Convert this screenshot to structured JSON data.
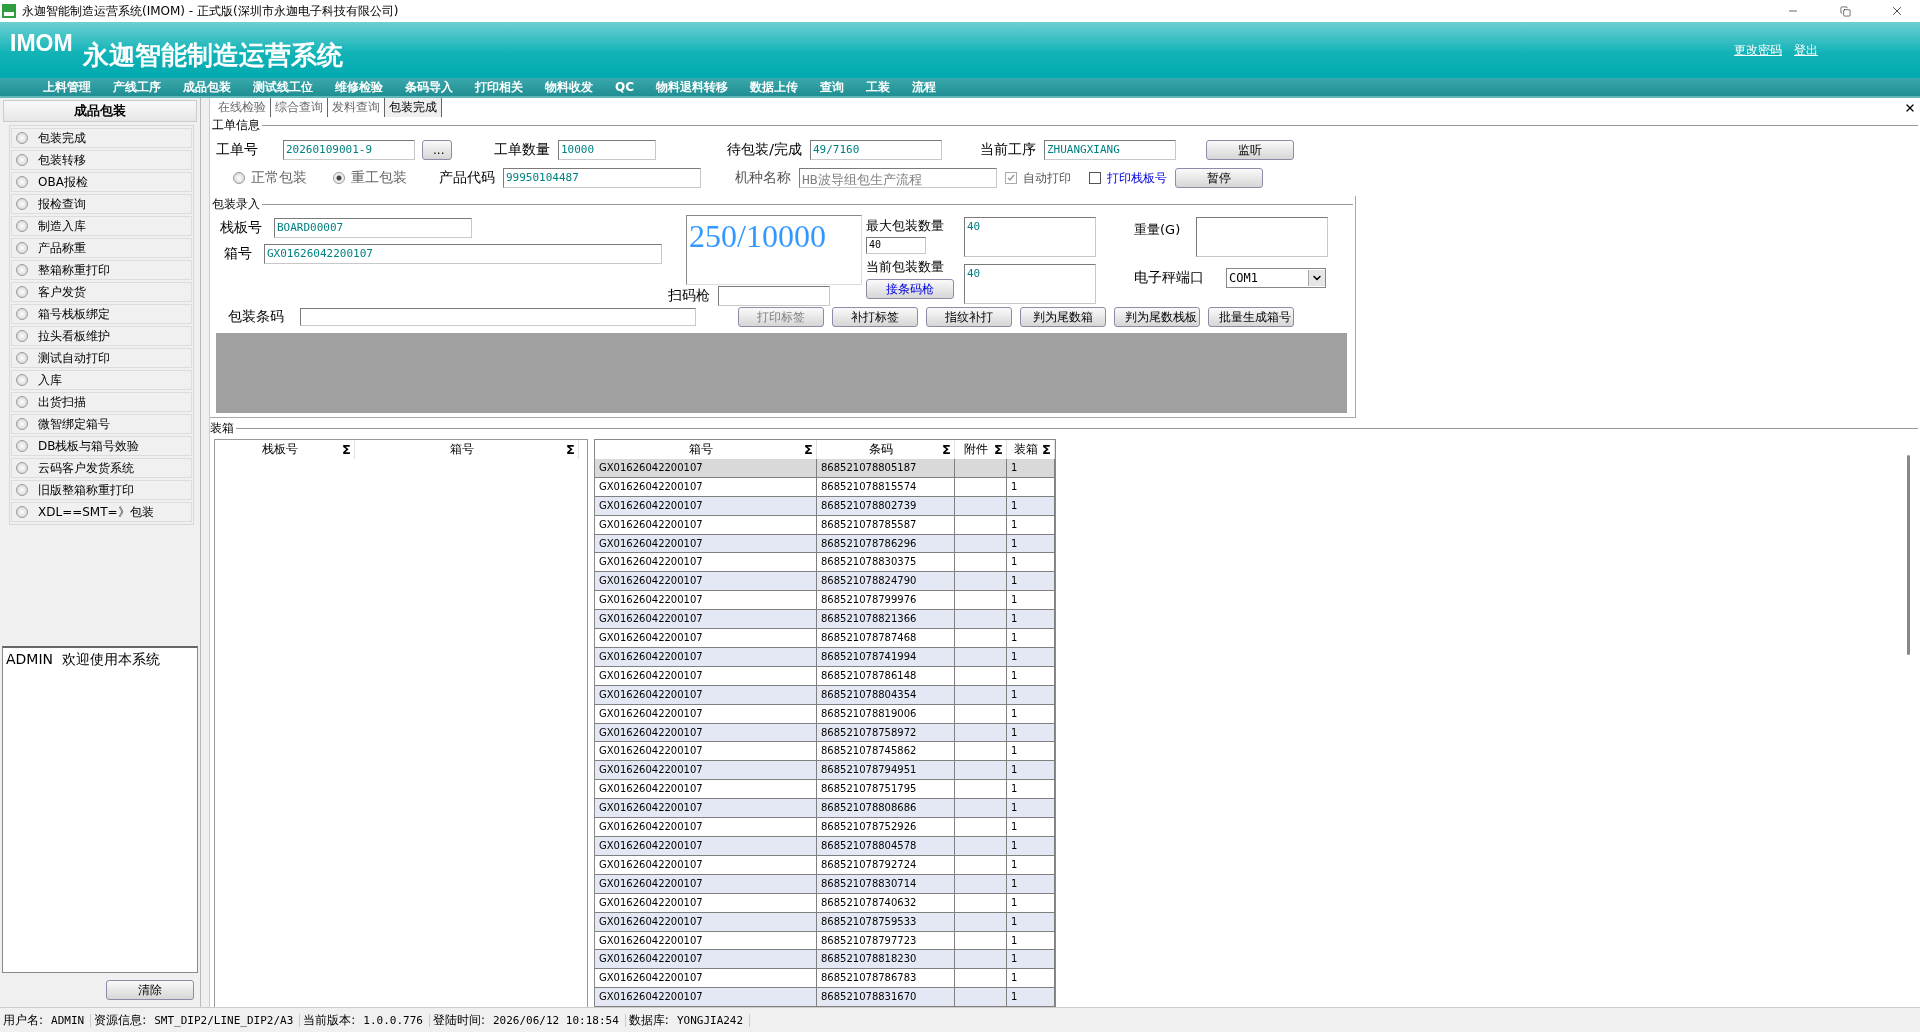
{
  "window": {
    "title": "永迦智能制造运营系统(IMOM) - 正式版(深圳市永迦电子科技有限公司)"
  },
  "header": {
    "logo": "IMOM",
    "title": "永迦智能制造运营系统",
    "links": [
      "更改密码",
      "登出"
    ]
  },
  "menu": [
    "上料管理",
    "产线工序",
    "成品包装",
    "测试线工位",
    "维修检验",
    "条码导入",
    "打印相关",
    "物料收发",
    "QC",
    "物料退料转移",
    "数据上传",
    "查询",
    "工装",
    "流程"
  ],
  "sidebar": {
    "title": "成品包装",
    "items": [
      {
        "label": "包装完成",
        "selected": false
      },
      {
        "label": "包装转移",
        "selected": false
      },
      {
        "label": "OBA报检",
        "selected": false
      },
      {
        "label": "报检查询",
        "selected": false
      },
      {
        "label": "制造入库",
        "selected": false
      },
      {
        "label": "产品称重",
        "selected": false
      },
      {
        "label": "整箱称重打印",
        "selected": false
      },
      {
        "label": "客户发货",
        "selected": false
      },
      {
        "label": "箱号栈板绑定",
        "selected": false
      },
      {
        "label": "拉头看板维护",
        "selected": false
      },
      {
        "label": "测试自动打印",
        "selected": false
      },
      {
        "label": "入库",
        "selected": false
      },
      {
        "label": "出货扫描",
        "selected": false
      },
      {
        "label": "微智绑定箱号",
        "selected": false
      },
      {
        "label": "DB栈板与箱号效验",
        "selected": false
      },
      {
        "label": "云码客户发货系统",
        "selected": false
      },
      {
        "label": "旧版整箱称重打印",
        "selected": false
      },
      {
        "label": "XDL==SMT=》包装",
        "selected": false
      }
    ],
    "message": "ADMIN  欢迎使用本系统",
    "clear_button": "清除"
  },
  "tabs": [
    {
      "label": "在线检验",
      "selected": false
    },
    {
      "label": "综合查询",
      "selected": false
    },
    {
      "label": "发料查询",
      "selected": false
    },
    {
      "label": "包装完成",
      "selected": true
    }
  ],
  "order_info": {
    "title": "工单信息",
    "order_no": {
      "label": "工单号",
      "value": "20260109001-9"
    },
    "browse_button": "...",
    "quantity": {
      "label": "工单数量",
      "value": "10000"
    },
    "pending_done": {
      "label": "待包装/完成",
      "value": "49/7160"
    },
    "current_process": {
      "label": "当前工序",
      "value": "ZHUANGXIANG"
    },
    "listen_button": "监听",
    "pack_modes": [
      {
        "label": "正常包装",
        "selected": false
      },
      {
        "label": "重工包装",
        "selected": true
      }
    ],
    "product_code": {
      "label": "产品代码",
      "value": "99950104487"
    },
    "model_name": {
      "label": "机种名称",
      "value": "HB波导组包生产流程",
      "disabled": true
    },
    "auto_print": {
      "label": "自动打印",
      "checked": true,
      "disabled": true
    },
    "print_pallet": {
      "label": "打印栈板号",
      "checked": false,
      "disabled": false
    },
    "pause_button": "暂停"
  },
  "packing": {
    "title": "包装录入",
    "pallet": {
      "label": "栈板号",
      "value": "BOARD00007"
    },
    "box": {
      "label": "箱号",
      "value": "GX01626042200107"
    },
    "counter": "250/10000",
    "max_qty": {
      "label": "最大包装数量",
      "input": "40",
      "value": "40"
    },
    "current_qty": {
      "label": "当前包装数量",
      "value": "40"
    },
    "weight": {
      "label": "重量(G)"
    },
    "scale_port": {
      "label": "电子秤端口",
      "value": "COM1"
    },
    "scanner": {
      "label": "扫码枪"
    },
    "scanner_button": "接条码枪",
    "barcode": {
      "label": "包装条码"
    },
    "buttons": [
      {
        "label": "打印标签",
        "disabled": true
      },
      {
        "label": "补打标签",
        "disabled": false
      },
      {
        "label": "指纹补打",
        "disabled": false
      },
      {
        "label": "判为尾数箱",
        "disabled": false
      },
      {
        "label": "判为尾数栈板",
        "disabled": false
      },
      {
        "label": "批量生成箱号",
        "disabled": false
      }
    ]
  },
  "boxing": {
    "title": "装箱",
    "left_table": {
      "columns": [
        {
          "label": "栈板号",
          "sum": "Σ"
        },
        {
          "label": "箱号",
          "sum": "Σ"
        }
      ]
    },
    "right_table": {
      "columns": [
        {
          "label": "箱号",
          "sum": "Σ"
        },
        {
          "label": "条码",
          "sum": "Σ"
        },
        {
          "label": "附件",
          "sum": "Σ"
        },
        {
          "label": "装箱",
          "sum": "Σ"
        }
      ],
      "rows": [
        {
          "box": "GX01626042200107",
          "barcode": "868521078805187",
          "qty": "1",
          "selected": true
        },
        {
          "box": "GX01626042200107",
          "barcode": "868521078815574",
          "qty": "1",
          "selected": false
        },
        {
          "box": "GX01626042200107",
          "barcode": "868521078802739",
          "qty": "1",
          "selected": false
        },
        {
          "box": "GX01626042200107",
          "barcode": "868521078785587",
          "qty": "1",
          "selected": false
        },
        {
          "box": "GX01626042200107",
          "barcode": "868521078786296",
          "qty": "1",
          "selected": false
        },
        {
          "box": "GX01626042200107",
          "barcode": "868521078830375",
          "qty": "1",
          "selected": false
        },
        {
          "box": "GX01626042200107",
          "barcode": "868521078824790",
          "qty": "1",
          "selected": false
        },
        {
          "box": "GX01626042200107",
          "barcode": "868521078799976",
          "qty": "1",
          "selected": false
        },
        {
          "box": "GX01626042200107",
          "barcode": "868521078821366",
          "qty": "1",
          "selected": false
        },
        {
          "box": "GX01626042200107",
          "barcode": "868521078787468",
          "qty": "1",
          "selected": false
        },
        {
          "box": "GX01626042200107",
          "barcode": "868521078741994",
          "qty": "1",
          "selected": false
        },
        {
          "box": "GX01626042200107",
          "barcode": "868521078786148",
          "qty": "1",
          "selected": false
        },
        {
          "box": "GX01626042200107",
          "barcode": "868521078804354",
          "qty": "1",
          "selected": false
        },
        {
          "box": "GX01626042200107",
          "barcode": "868521078819006",
          "qty": "1",
          "selected": false
        },
        {
          "box": "GX01626042200107",
          "barcode": "868521078758972",
          "qty": "1",
          "selected": false
        },
        {
          "box": "GX01626042200107",
          "barcode": "868521078745862",
          "qty": "1",
          "selected": false
        },
        {
          "box": "GX01626042200107",
          "barcode": "868521078794951",
          "qty": "1",
          "selected": false
        },
        {
          "box": "GX01626042200107",
          "barcode": "868521078751795",
          "qty": "1",
          "selected": false
        },
        {
          "box": "GX01626042200107",
          "barcode": "868521078808686",
          "qty": "1",
          "selected": false
        },
        {
          "box": "GX01626042200107",
          "barcode": "868521078752926",
          "qty": "1",
          "selected": false
        },
        {
          "box": "GX01626042200107",
          "barcode": "868521078804578",
          "qty": "1",
          "selected": false
        },
        {
          "box": "GX01626042200107",
          "barcode": "868521078792724",
          "qty": "1",
          "selected": false
        },
        {
          "box": "GX01626042200107",
          "barcode": "868521078830714",
          "qty": "1",
          "selected": false
        },
        {
          "box": "GX01626042200107",
          "barcode": "868521078740632",
          "qty": "1",
          "selected": false
        },
        {
          "box": "GX01626042200107",
          "barcode": "868521078759533",
          "qty": "1",
          "selected": false
        },
        {
          "box": "GX01626042200107",
          "barcode": "868521078797723",
          "qty": "1",
          "selected": false
        },
        {
          "box": "GX01626042200107",
          "barcode": "868521078818230",
          "qty": "1",
          "selected": false
        },
        {
          "box": "GX01626042200107",
          "barcode": "868521078786783",
          "qty": "1",
          "selected": false
        },
        {
          "box": "GX01626042200107",
          "barcode": "868521078831670",
          "qty": "1",
          "selected": false
        }
      ]
    }
  },
  "status_bar": [
    {
      "label": "用户名:",
      "value": "ADMIN"
    },
    {
      "label": "资源信息:",
      "value": "SMT_DIP2/LINE_DIP2/A3"
    },
    {
      "label": "当前版本:",
      "value": "1.0.0.776"
    },
    {
      "label": "登陆时间:",
      "value": "2026/06/12 10:18:54"
    },
    {
      "label": "数据库:",
      "value": "YONGJIA242"
    }
  ]
}
